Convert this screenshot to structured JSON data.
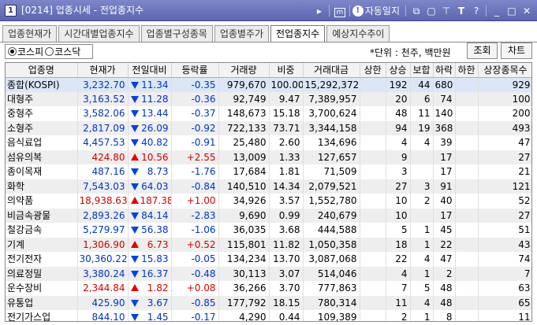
{
  "window": {
    "code": "[0214]",
    "title": "업종시세 - 전업종지수",
    "buttons": {
      "m_label": "m",
      "info_label": "자동일지",
      "t_label": "T",
      "help_label": "?",
      "minimize": "_",
      "maximize": "□",
      "close": "✕"
    }
  },
  "tabs": [
    "업종현재가",
    "시간대별업종지수",
    "업종별구성종목",
    "업종별주가",
    "전업종지수",
    "예상지수추이"
  ],
  "active_tab": 4,
  "market_radio": {
    "options": [
      "코스피",
      "코스닥"
    ],
    "selected": 0
  },
  "unit_text": "*단위 : 천주, 백만원",
  "query_button": "조회",
  "chart_button": "차트",
  "table": {
    "headers": [
      "업종명",
      "현재가",
      "전일대비",
      "등락률",
      "거래량",
      "비중",
      "거래대금",
      "상한",
      "상승",
      "보합",
      "하락",
      "하한",
      "상장종목수"
    ],
    "rows": [
      {
        "name": "종합(KOSPI)",
        "price": "3,232.70",
        "dir": "down",
        "diff": "11.34",
        "rate": "-0.35",
        "volume": "979,670",
        "weight": "100.00",
        "amount": "15,292,372",
        "upper": "",
        "rise": "192",
        "flat": "44",
        "fall": "680",
        "lower": "",
        "listed": "929"
      },
      {
        "name": "대형주",
        "price": "3,163.52",
        "dir": "down",
        "diff": "11.28",
        "rate": "-0.36",
        "volume": "92,749",
        "weight": "9.47",
        "amount": "7,389,957",
        "upper": "",
        "rise": "20",
        "flat": "6",
        "fall": "74",
        "lower": "",
        "listed": "100"
      },
      {
        "name": "중형주",
        "price": "3,582.06",
        "dir": "down",
        "diff": "13.44",
        "rate": "-0.37",
        "volume": "148,673",
        "weight": "15.18",
        "amount": "3,700,624",
        "upper": "",
        "rise": "48",
        "flat": "11",
        "fall": "140",
        "lower": "",
        "listed": "200"
      },
      {
        "name": "소형주",
        "price": "2,817.09",
        "dir": "down",
        "diff": "26.09",
        "rate": "-0.92",
        "volume": "722,133",
        "weight": "73.71",
        "amount": "3,344,158",
        "upper": "",
        "rise": "94",
        "flat": "19",
        "fall": "368",
        "lower": "",
        "listed": "493"
      },
      {
        "name": "음식료업",
        "price": "4,457.53",
        "dir": "down",
        "diff": "40.82",
        "rate": "-0.91",
        "volume": "25,480",
        "weight": "2.60",
        "amount": "134,696",
        "upper": "",
        "rise": "4",
        "flat": "4",
        "fall": "39",
        "lower": "",
        "listed": "47"
      },
      {
        "name": "섬유의복",
        "price": "424.80",
        "dir": "up",
        "diff": "10.56",
        "rate": "+2.55",
        "volume": "13,009",
        "weight": "1.33",
        "amount": "127,657",
        "upper": "",
        "rise": "9",
        "flat": "",
        "fall": "17",
        "lower": "",
        "listed": "27"
      },
      {
        "name": "종이목재",
        "price": "487.16",
        "dir": "down",
        "diff": "8.73",
        "rate": "-1.76",
        "volume": "17,684",
        "weight": "1.81",
        "amount": "71,509",
        "upper": "",
        "rise": "3",
        "flat": "",
        "fall": "17",
        "lower": "",
        "listed": "21"
      },
      {
        "name": "화학",
        "price": "7,543.03",
        "dir": "down",
        "diff": "64.03",
        "rate": "-0.84",
        "volume": "140,510",
        "weight": "14.34",
        "amount": "2,079,521",
        "upper": "",
        "rise": "27",
        "flat": "3",
        "fall": "91",
        "lower": "",
        "listed": "121"
      },
      {
        "name": "의약품",
        "price": "18,938.63",
        "dir": "up",
        "diff": "187.38",
        "rate": "+1.00",
        "volume": "34,926",
        "weight": "3.57",
        "amount": "1,552,780",
        "upper": "",
        "rise": "10",
        "flat": "2",
        "fall": "40",
        "lower": "",
        "listed": "52"
      },
      {
        "name": "비금속광물",
        "price": "2,893.26",
        "dir": "down",
        "diff": "84.14",
        "rate": "-2.83",
        "volume": "9,690",
        "weight": "0.99",
        "amount": "240,679",
        "upper": "",
        "rise": "10",
        "flat": "",
        "fall": "17",
        "lower": "",
        "listed": "27"
      },
      {
        "name": "철강금속",
        "price": "5,279.97",
        "dir": "down",
        "diff": "56.38",
        "rate": "-1.06",
        "volume": "36,035",
        "weight": "3.68",
        "amount": "444,588",
        "upper": "",
        "rise": "5",
        "flat": "1",
        "fall": "45",
        "lower": "",
        "listed": "51"
      },
      {
        "name": "기계",
        "price": "1,306.90",
        "dir": "up",
        "diff": "6.73",
        "rate": "+0.52",
        "volume": "115,801",
        "weight": "11.82",
        "amount": "1,050,358",
        "upper": "",
        "rise": "18",
        "flat": "1",
        "fall": "22",
        "lower": "",
        "listed": "43"
      },
      {
        "name": "전기전자",
        "price": "30,360.22",
        "dir": "down",
        "diff": "15.83",
        "rate": "-0.05",
        "volume": "134,234",
        "weight": "13.70",
        "amount": "3,087,068",
        "upper": "",
        "rise": "22",
        "flat": "4",
        "fall": "47",
        "lower": "",
        "listed": "74"
      },
      {
        "name": "의료정밀",
        "price": "3,380.24",
        "dir": "down",
        "diff": "16.37",
        "rate": "-0.48",
        "volume": "30,113",
        "weight": "3.07",
        "amount": "514,046",
        "upper": "",
        "rise": "4",
        "flat": "1",
        "fall": "2",
        "lower": "",
        "listed": "7"
      },
      {
        "name": "운수장비",
        "price": "2,344.84",
        "dir": "up",
        "diff": "1.82",
        "rate": "+0.08",
        "volume": "36,266",
        "weight": "3.70",
        "amount": "777,863",
        "upper": "",
        "rise": "7",
        "flat": "5",
        "fall": "48",
        "lower": "",
        "listed": "63"
      },
      {
        "name": "유통업",
        "price": "425.90",
        "dir": "down",
        "diff": "3.67",
        "rate": "-0.85",
        "volume": "177,792",
        "weight": "18.15",
        "amount": "780,314",
        "upper": "",
        "rise": "11",
        "flat": "4",
        "fall": "48",
        "lower": "",
        "listed": "65"
      },
      {
        "name": "전기가스업",
        "price": "844.10",
        "dir": "down",
        "diff": "1.45",
        "rate": "-0.17",
        "volume": "4,290",
        "weight": "0.44",
        "amount": "109,389",
        "upper": "",
        "rise": "2",
        "flat": "1",
        "fall": "8",
        "lower": "",
        "listed": "11"
      }
    ]
  },
  "colors": {
    "up": "#d40000",
    "down": "#0033cc",
    "titlebar": "#6a73bc",
    "selected_row": "#dbe7f6",
    "alt_row": "#eeeeee"
  }
}
